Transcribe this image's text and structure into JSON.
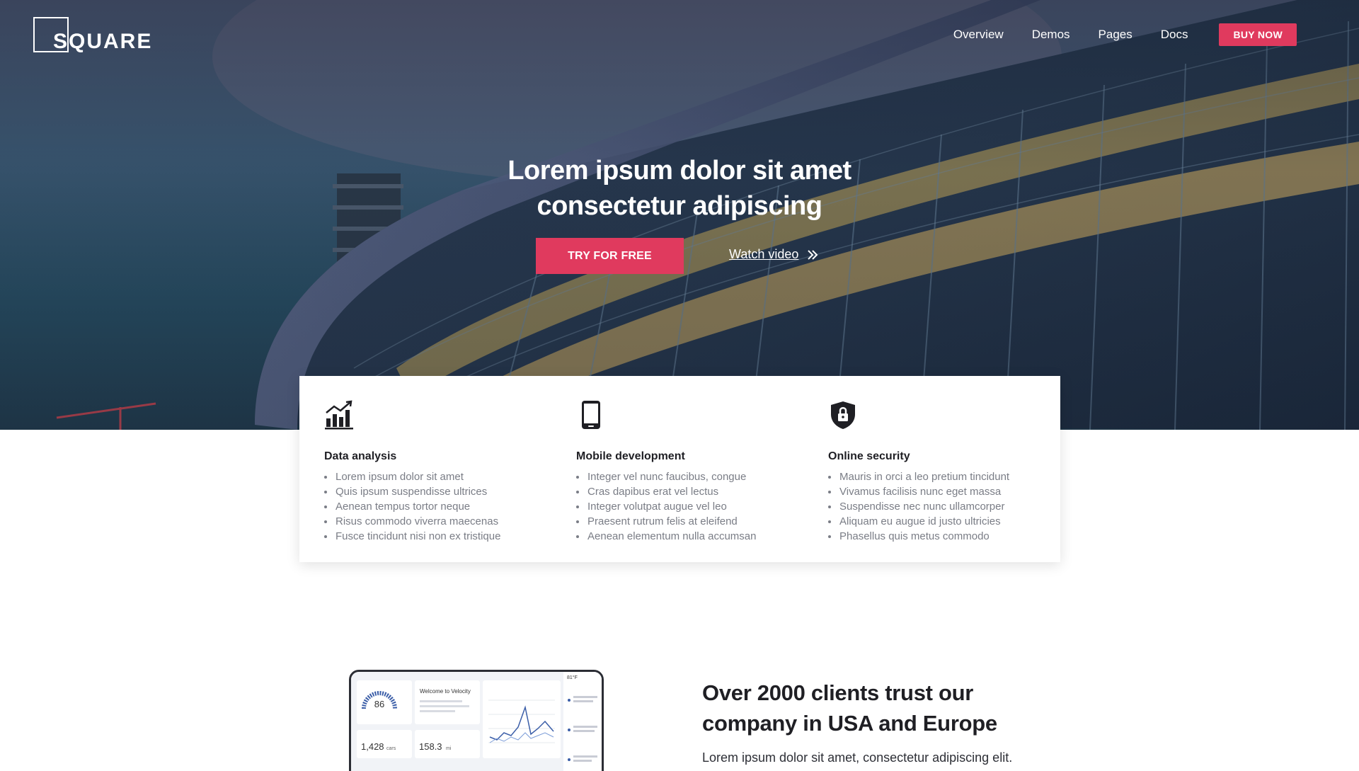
{
  "brand": {
    "logo_text": "SQUARE"
  },
  "nav": {
    "items": [
      "Overview",
      "Demos",
      "Pages",
      "Docs"
    ],
    "buy_label": "BUY NOW"
  },
  "hero": {
    "title_line1": "Lorem ipsum dolor sit amet",
    "title_line2": "consectetur adipiscing",
    "try_label": "TRY FOR FREE",
    "watch_label": "Watch video"
  },
  "features": [
    {
      "icon": "bar-chart-icon",
      "title": "Data analysis",
      "items": [
        "Lorem ipsum dolor sit amet",
        "Quis ipsum suspendisse ultrices",
        "Aenean tempus tortor neque",
        "Risus commodo viverra maecenas",
        "Fusce tincidunt nisi non ex tristique"
      ]
    },
    {
      "icon": "smartphone-icon",
      "title": "Mobile development",
      "items": [
        "Integer vel nunc faucibus, congue",
        "Cras dapibus erat vel lectus",
        "Integer volutpat augue vel leo",
        "Praesent rutrum felis at eleifend",
        "Aenean elementum nulla accumsan"
      ]
    },
    {
      "icon": "shield-lock-icon",
      "title": "Online security",
      "items": [
        "Mauris in orci a leo pretium tincidunt",
        "Vivamus facilisis nunc eget massa",
        "Suspendisse nec nunc ullamcorper",
        "Aliquam eu augue id justo ultricies",
        "Phasellus quis metus commodo"
      ]
    }
  ],
  "clients": {
    "title_line1": "Over 2000 clients trust our",
    "title_line2": "company in USA and Europe",
    "subtitle": "Lorem ipsum dolor sit amet, consectetur adipiscing elit."
  },
  "device": {
    "gauge_value": "86",
    "welcome": "Welcome to Velocity",
    "cars_value": "1,428",
    "cars_unit": "cars",
    "miles_value": "158.3",
    "miles_unit": "mi",
    "weather": "81°F"
  },
  "colors": {
    "accent": "#e03a5e",
    "text": "#1f1f24",
    "muted": "#7a7d86"
  }
}
